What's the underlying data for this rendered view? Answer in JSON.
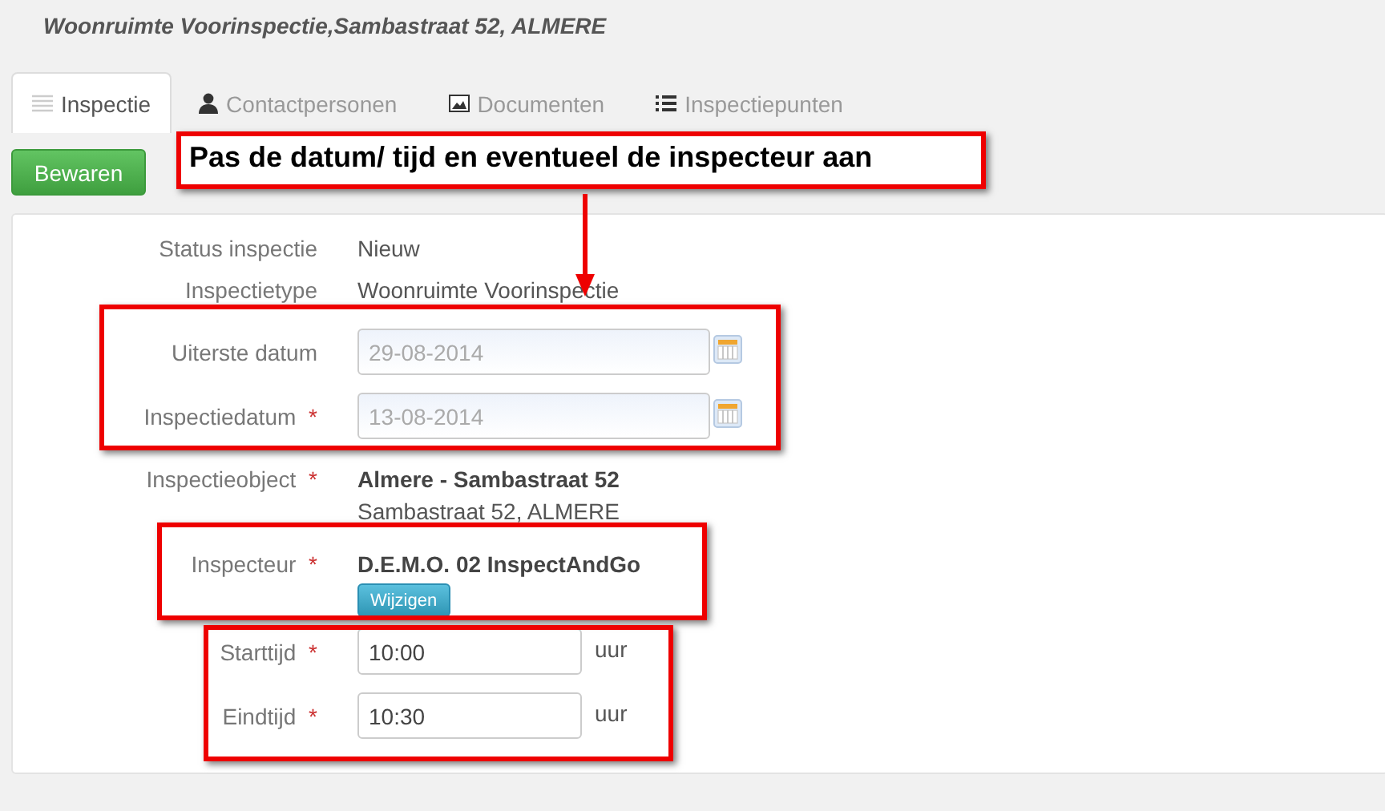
{
  "page_title": "Woonruimte Voorinspectie,Sambastraat 52, ALMERE",
  "tabs": [
    {
      "label": "Inspectie",
      "selected": true
    },
    {
      "label": "Contactpersonen",
      "selected": false
    },
    {
      "label": "Documenten",
      "selected": false
    },
    {
      "label": "Inspectiepunten",
      "selected": false
    }
  ],
  "save_button": "Bewaren",
  "callout": "Pas de datum/ tijd en eventueel de inspecteur aan",
  "fields": [
    {
      "kind": "text",
      "label": "Status inspectie",
      "value": "Nieuw"
    },
    {
      "kind": "text",
      "label": "Inspectietype",
      "value": "Woonruimte Voorinspectie"
    },
    {
      "kind": "date",
      "label": "Uiterste datum",
      "value": "29-08-2014"
    },
    {
      "kind": "date",
      "label": "Inspectiedatum",
      "required_mark": "*",
      "value": "13-08-2014"
    },
    {
      "kind": "object",
      "label": "Inspectieobject",
      "required_mark": "*",
      "value": "Almere - Sambastraat 52",
      "detail": "Sambastraat 52, ALMERE"
    },
    {
      "kind": "inspector",
      "label": "Inspecteur",
      "required_mark": "*",
      "value": "D.E.M.O. 02 InspectAndGo",
      "button": "Wijzigen"
    },
    {
      "kind": "time",
      "label": "Starttijd",
      "required_mark": "*",
      "value": "10:00",
      "unit": "uur"
    },
    {
      "kind": "time",
      "label": "Eindtijd",
      "required_mark": "*",
      "value": "10:30",
      "unit": "uur"
    }
  ]
}
